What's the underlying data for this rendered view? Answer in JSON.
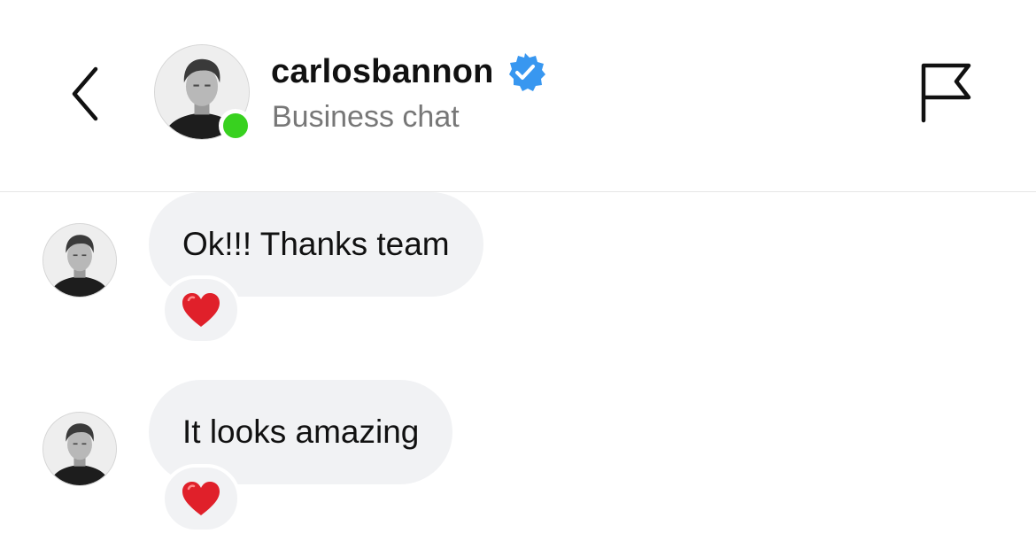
{
  "header": {
    "username": "carlosbannon",
    "subtitle": "Business chat",
    "verified": true,
    "online": true,
    "accent_colors": {
      "verified_badge": "#3897f0",
      "online_dot": "#38d11f"
    },
    "icons": {
      "back": "chevron-left-icon",
      "report": "flag-icon",
      "verified": "verified-badge-icon"
    }
  },
  "messages": [
    {
      "text": "Ok!!! Thanks team",
      "reaction": "heart"
    },
    {
      "text": "It looks amazing",
      "reaction": "heart"
    }
  ],
  "colors": {
    "bubble": "#f1f2f4",
    "heart": "#e0202a",
    "subtitle": "#777777"
  }
}
